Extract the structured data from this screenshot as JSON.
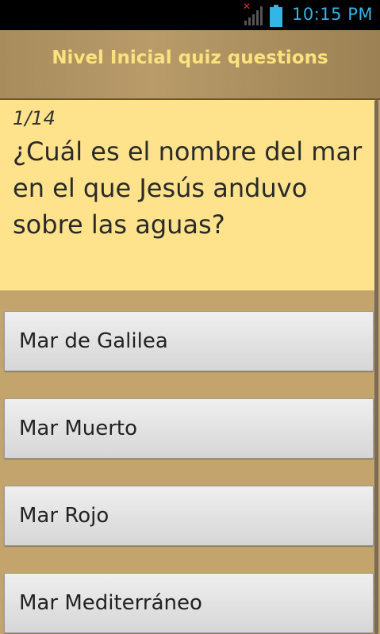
{
  "status_bar": {
    "time": "10:15 PM",
    "signal_icon": "signal-no-data-icon",
    "battery_icon": "battery-icon"
  },
  "header": {
    "title": "Nivel Inicial quiz questions"
  },
  "question": {
    "counter": "1/14",
    "text": "¿Cuál es el nombre del mar en el que Jesús anduvo sobre las aguas?"
  },
  "answers": [
    {
      "label": "Mar de Galilea"
    },
    {
      "label": "Mar Muerto"
    },
    {
      "label": "Mar Rojo"
    },
    {
      "label": "Mar Mediterráneo"
    }
  ],
  "colors": {
    "background": "#c2a46c",
    "question_bg": "#fee38c",
    "title_text": "#fbe27c",
    "status_accent": "#33b5e5"
  }
}
